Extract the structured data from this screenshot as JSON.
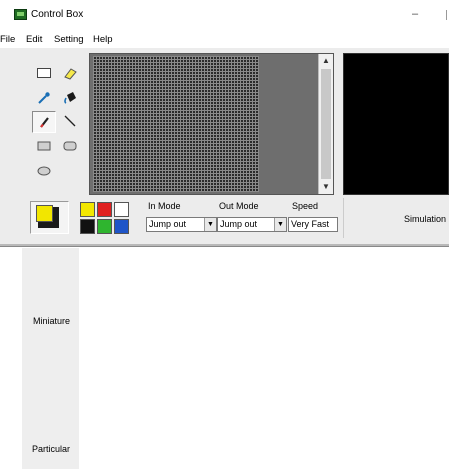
{
  "window": {
    "title": "Control Box",
    "minimize_glyph": "–",
    "icon": "app-icon"
  },
  "menu": [
    "File",
    "Edit",
    "Setting",
    "Help"
  ],
  "tools": [
    {
      "name": "rectangle-outline-tool",
      "icon": "rectangle-icon"
    },
    {
      "name": "eraser-tool",
      "icon": "eraser-icon"
    },
    {
      "name": "eyedropper-tool",
      "icon": "eyedropper-icon"
    },
    {
      "name": "fill-tool",
      "icon": "paint-bucket-icon"
    },
    {
      "name": "pencil-tool",
      "icon": "pencil-icon",
      "selected": true
    },
    {
      "name": "line-tool",
      "icon": "line-icon"
    },
    {
      "name": "filled-rectangle-tool",
      "icon": "filled-rectangle-icon"
    },
    {
      "name": "rounded-rectangle-tool",
      "icon": "rounded-rectangle-icon"
    },
    {
      "name": "ellipse-tool",
      "icon": "ellipse-icon"
    }
  ],
  "colors": {
    "current_foreground": "#f2e600",
    "current_background": "#1a1a1a",
    "palette": [
      "#f2e600",
      "#e02020",
      "#ffffff",
      "#111111",
      "#2fb52f",
      "#1f55c8"
    ]
  },
  "modes": {
    "in_mode_label": "In Mode",
    "in_mode_value": "Jump out",
    "out_mode_label": "Out Mode",
    "out_mode_value": "Jump out",
    "speed_label": "Speed",
    "speed_value": "Very Fast"
  },
  "simulation_label": "Simulation",
  "side_tabs": [
    {
      "label": "Miniature"
    },
    {
      "label": "Particular"
    }
  ]
}
